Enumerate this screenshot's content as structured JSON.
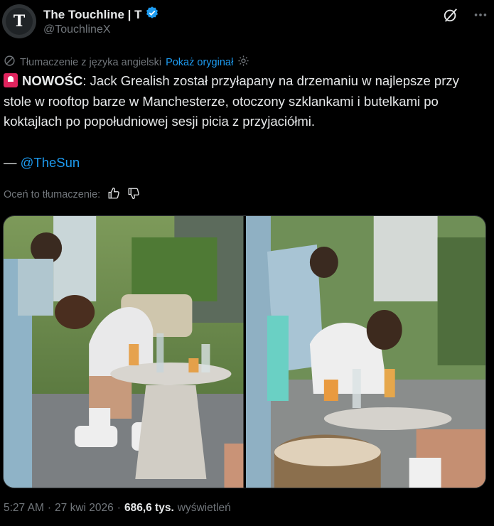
{
  "account": {
    "avatar_letter": "T",
    "display_name": "The Touchline | T",
    "handle": "@TouchlineX",
    "verified": true
  },
  "header_icons": [
    "grok-icon",
    "more-icon"
  ],
  "translation": {
    "label": "Tłumaczenie z języka angielski",
    "show_original": "Pokaż oryginał"
  },
  "tweet": {
    "emoji": "rotating-light-icon",
    "bold_prefix": "NOWOŚC",
    "body": ": Jack Grealish został przyłapany na drzemaniu w najlepsze przy stole w rooftop barze w Manchesterze, otoczony szklankami i butelkami po koktajlach po popołudniowej sesji picia z przyjaciółmi.",
    "credit_dash": "— ",
    "credit_mention": "@TheSun"
  },
  "rate": {
    "label": "Oceń to tłumaczenie:"
  },
  "media": {
    "photos": [
      "photo-1",
      "photo-2"
    ]
  },
  "meta": {
    "time": "5:27 AM",
    "sep1": "·",
    "date": "27 kwi 2026",
    "sep2": "·",
    "views": "686,6 tys.",
    "views_label": "wyświetleń"
  },
  "colors": {
    "background": "#000000",
    "text": "#e7e9ea",
    "muted": "#71767b",
    "accent": "#1d9bf0"
  }
}
